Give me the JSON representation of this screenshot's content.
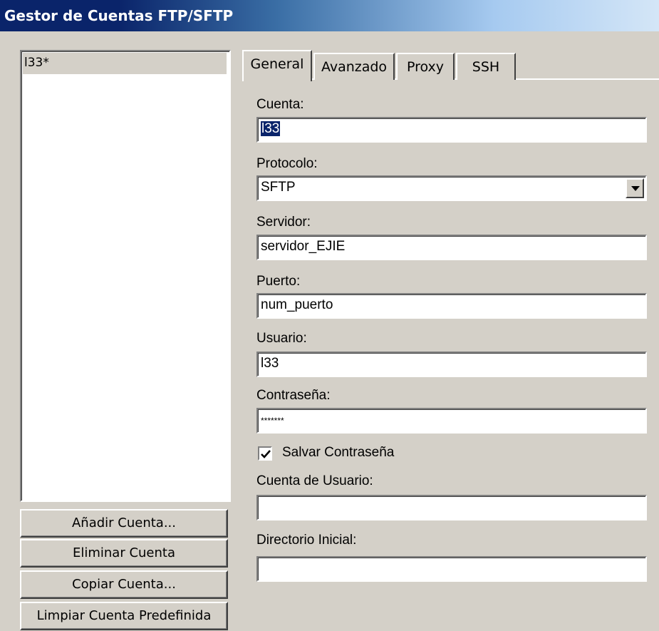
{
  "window": {
    "title": "Gestor de Cuentas FTP/SFTP"
  },
  "accounts": {
    "items": [
      "l33*"
    ]
  },
  "buttons": {
    "add": "Añadir Cuenta...",
    "remove": "Eliminar Cuenta",
    "copy": "Copiar Cuenta...",
    "clear_default": "Limpiar Cuenta Predefinida"
  },
  "tabs": [
    "General",
    "Avanzado",
    "Proxy",
    "SSH"
  ],
  "form": {
    "account_label": "Cuenta:",
    "account_value": "l33",
    "protocol_label": "Protocolo:",
    "protocol_value": "SFTP",
    "server_label": "Servidor:",
    "server_value": "servidor_EJIE",
    "port_label": "Puerto:",
    "port_value": "num_puerto",
    "user_label": "Usuario:",
    "user_value": "l33",
    "password_label": "Contraseña:",
    "password_value": "*******",
    "save_password_label": "Salvar Contraseña",
    "user_account_label": "Cuenta de Usuario:",
    "user_account_value": "",
    "initial_dir_label": "Directorio Inicial:",
    "initial_dir_value": ""
  },
  "icons": {
    "dropdown": "chevron-down-icon",
    "check": "checkmark-icon"
  },
  "colors": {
    "title_bar": "#0a246a",
    "selection": "#0a246a",
    "face": "#d4d0c8"
  }
}
